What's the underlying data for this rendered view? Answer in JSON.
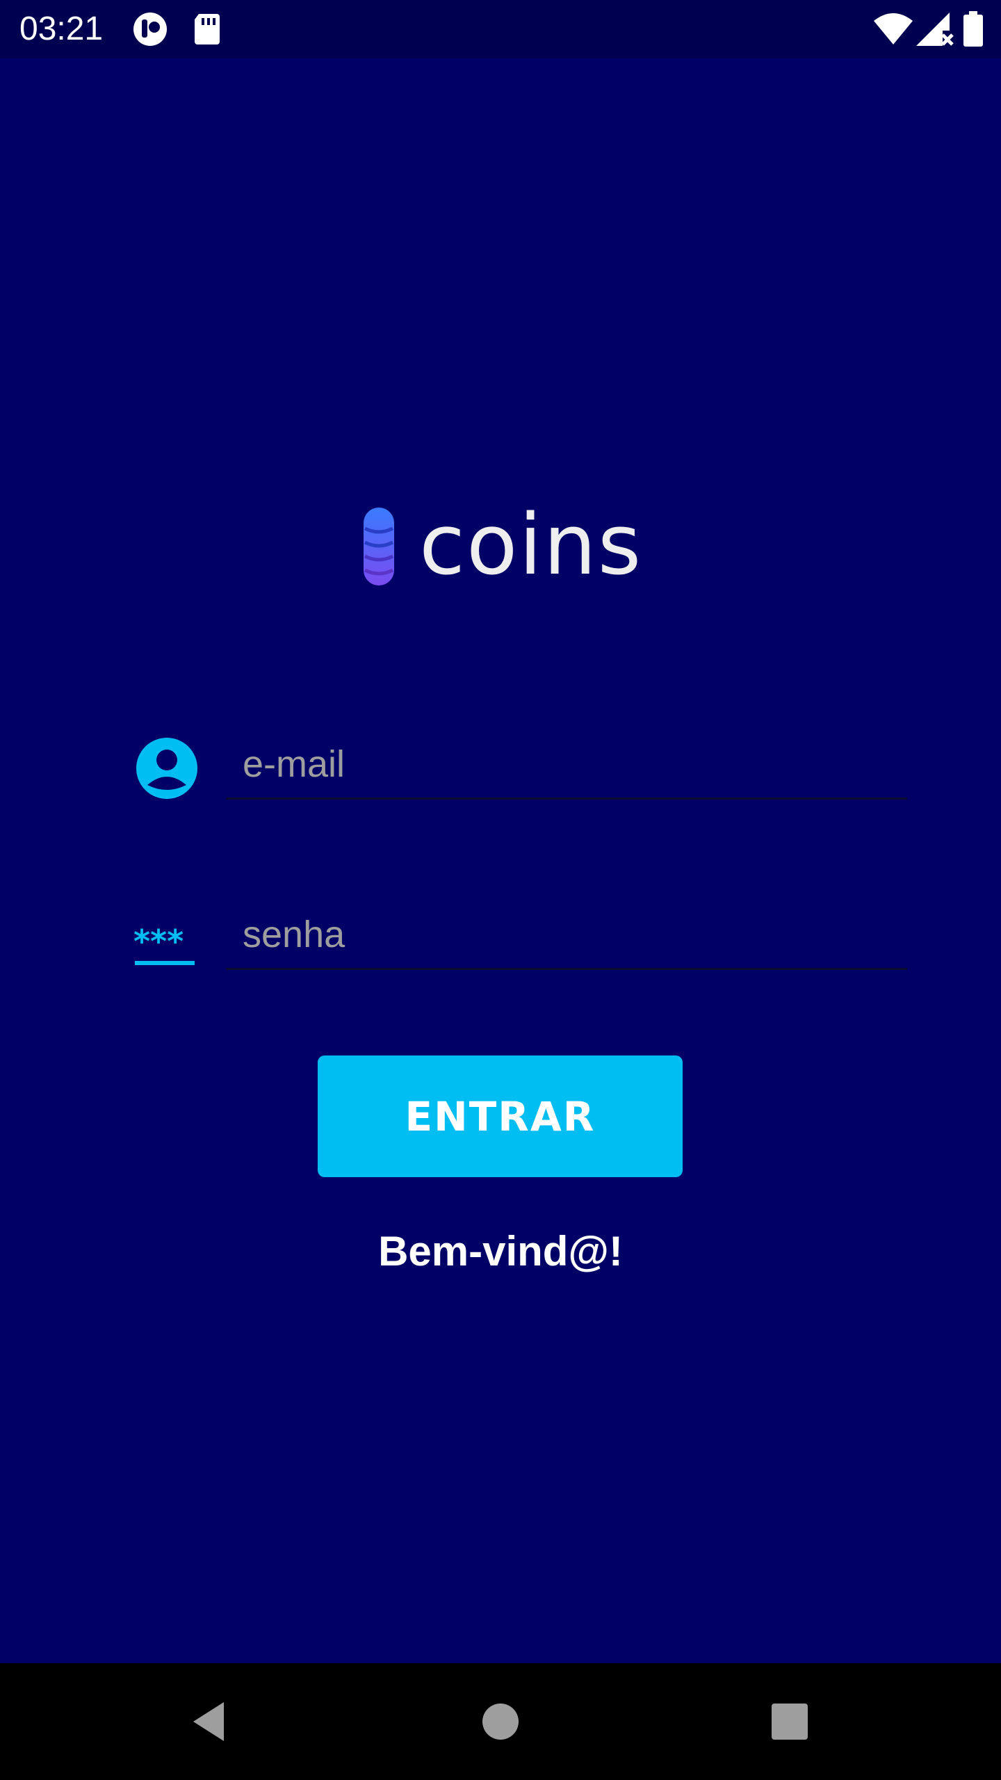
{
  "status_bar": {
    "time": "03:21",
    "icons": [
      "app-notification-icon",
      "sd-card-icon",
      "wifi-icon",
      "cellular-signal-icon",
      "battery-icon"
    ]
  },
  "logo": {
    "text": "coins"
  },
  "form": {
    "email": {
      "placeholder": "e-mail",
      "value": "",
      "icon": "account-circle-icon"
    },
    "password": {
      "placeholder": "senha",
      "value": "",
      "icon": "password-icon"
    },
    "submit_label": "ENTRAR"
  },
  "welcome_text": "Bem-vind@!",
  "nav_bar": {
    "buttons": [
      "back-icon",
      "home-icon",
      "recents-icon"
    ]
  },
  "colors": {
    "background": "#000066",
    "status_bar": "#000050",
    "accent": "#00bef2",
    "placeholder": "#9e9e9e",
    "nav_bar": "#000000"
  }
}
